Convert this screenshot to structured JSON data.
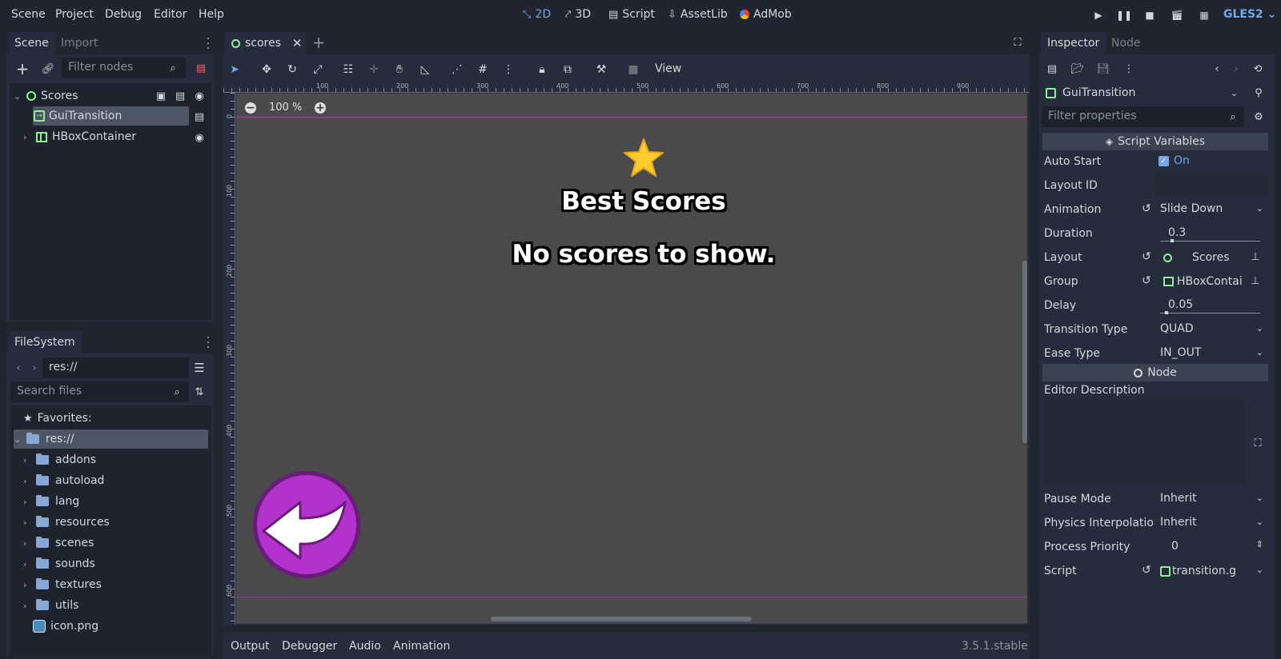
{
  "menu": [
    "Scene",
    "Project",
    "Debug",
    "Editor",
    "Help"
  ],
  "workspaces": [
    {
      "label": "2D",
      "icon": "2d-icon",
      "active": true
    },
    {
      "label": "3D",
      "icon": "3d-icon"
    },
    {
      "label": "Script",
      "icon": "script-icon"
    },
    {
      "label": "AssetLib",
      "icon": "assetlib-icon"
    },
    {
      "label": "AdMob",
      "icon": "admob-icon"
    }
  ],
  "renderer": "GLES2",
  "scene_dock": {
    "tabs": [
      "Scene",
      "Import"
    ],
    "filter_placeholder": "Filter nodes",
    "nodes": [
      {
        "label": "Scores",
        "icon": "control-icon"
      },
      {
        "label": "GuiTransition",
        "icon": "gui-transition-icon",
        "selected": true
      },
      {
        "label": "HBoxContainer",
        "icon": "hbox-icon"
      }
    ]
  },
  "filesystem": {
    "title": "FileSystem",
    "path": "res://",
    "search_placeholder": "Search files",
    "favorites": "Favorites:",
    "root": "res://",
    "folders": [
      "addons",
      "autoload",
      "lang",
      "resources",
      "scenes",
      "sounds",
      "textures",
      "utils"
    ],
    "files": [
      "icon.png"
    ]
  },
  "editor": {
    "tab": "scores",
    "zoom": "100 %",
    "view_label": "View",
    "ruler_h": [
      "100",
      "200",
      "300",
      "400",
      "500",
      "600",
      "700",
      "800",
      "900"
    ],
    "ruler_v": [
      "0",
      "100",
      "200",
      "300",
      "400",
      "500",
      "600"
    ],
    "game_title": "Best Scores",
    "game_message": "No scores to show.",
    "colors": {
      "canvas": "#4a4a4a",
      "star": "#ffcc2e",
      "back_button": "#b233cc"
    }
  },
  "bottom_panel": {
    "tabs": [
      "Output",
      "Debugger",
      "Audio",
      "Animation"
    ],
    "version": "3.5.1.stable"
  },
  "inspector": {
    "tabs": [
      "Inspector",
      "Node"
    ],
    "object": "GuiTransition",
    "filter_placeholder": "Filter properties",
    "section_script": "Script Variables",
    "section_node": "Node",
    "props": {
      "auto_start": {
        "label": "Auto Start",
        "value": "On"
      },
      "layout_id": {
        "label": "Layout ID",
        "value": ""
      },
      "animation": {
        "label": "Animation",
        "value": "Slide Down"
      },
      "duration": {
        "label": "Duration",
        "value": "0.3"
      },
      "layout": {
        "label": "Layout",
        "value": "Scores"
      },
      "group": {
        "label": "Group",
        "value": "HBoxContai"
      },
      "delay": {
        "label": "Delay",
        "value": "0.05"
      },
      "transition_type": {
        "label": "Transition Type",
        "value": "QUAD"
      },
      "ease_type": {
        "label": "Ease Type",
        "value": "IN_OUT"
      },
      "editor_description": {
        "label": "Editor Description",
        "value": ""
      },
      "pause_mode": {
        "label": "Pause Mode",
        "value": "Inherit"
      },
      "physics_interp": {
        "label": "Physics Interpolatio",
        "value": "Inherit"
      },
      "process_priority": {
        "label": "Process Priority",
        "value": "0"
      },
      "script": {
        "label": "Script",
        "value": "transition.g"
      }
    }
  }
}
